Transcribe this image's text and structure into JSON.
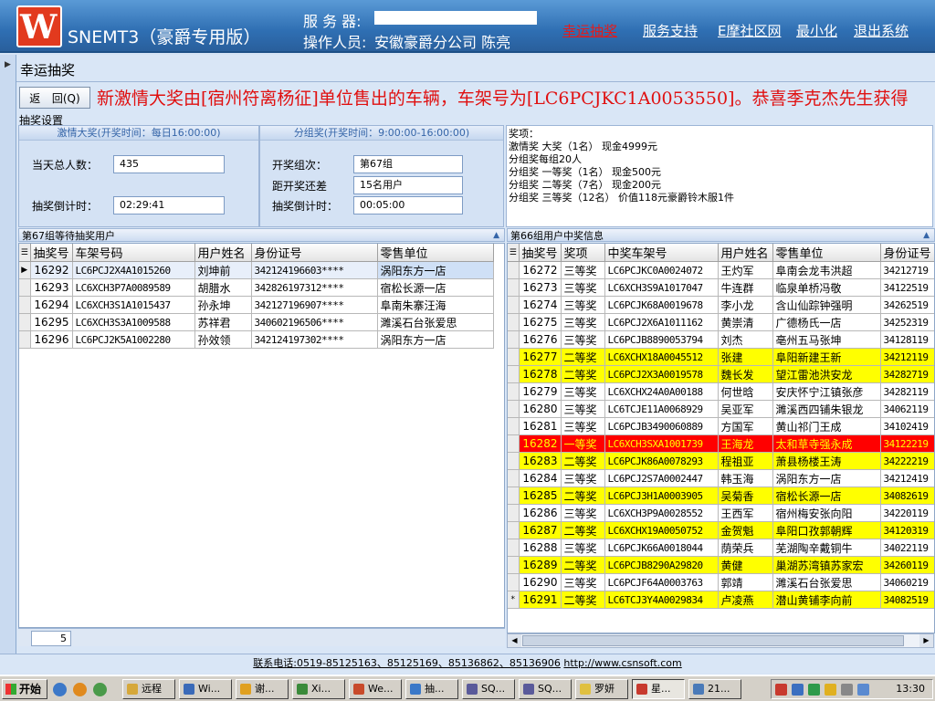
{
  "header": {
    "app_title": "SNEMT3（豪爵专用版）",
    "server_label": "服 务 器:",
    "operator_label": "操作人员:",
    "operator_value": "安徽豪爵分公司 陈亮",
    "nav": [
      "幸运抽奖",
      "服务支持",
      "E摩社区网",
      "最小化",
      "退出系统"
    ],
    "accent_color": "#e31b1b"
  },
  "page": {
    "title": "幸运抽奖",
    "back_label": "返",
    "back_label2": "回(Q)",
    "marquee": "新激情大奖由[宿州符离杨征]单位售出的车辆，车架号为[LC6PCJKC1A0053550]。恭喜季克杰先生获得"
  },
  "settings": {
    "title": "抽奖设置",
    "passion": {
      "heading": "激情大奖(开奖时间：每日16:00:00)",
      "total_label": "当天总人数：",
      "total_value": "435",
      "countdown_label": "抽奖倒计时：",
      "countdown_value": "02:29:41"
    },
    "group": {
      "heading": "分组奖(开奖时间：9:00:00-16:00:00)",
      "round_label": "开奖组次：",
      "round_value": "第67组",
      "gap_label": "距开奖还差",
      "gap_value": "15名用户",
      "countdown_label": "抽奖倒计时：",
      "countdown_value": "00:05:00"
    },
    "prizes": [
      "奖项：",
      "激情奖  大奖（1名）  现金4999元",
      "分组奖每组20人",
      "分组奖  一等奖（1名）  现金500元",
      "分组奖  二等奖（7名）  现金200元",
      "分组奖  三等奖（12名）  价值118元豪爵铃木服1件"
    ]
  },
  "waiting": {
    "title": "第67组等待抽奖用户",
    "columns": [
      "抽奖号",
      "车架号码",
      "用户姓名",
      "身份证号",
      "零售单位"
    ],
    "rows": [
      [
        "16292",
        "LC6PCJ2X4A1015260",
        "刘坤前",
        "342124196603****",
        "涡阳东方一店"
      ],
      [
        "16293",
        "LC6XCH3P7A0089589",
        "胡腊水",
        "342826197312****",
        "宿松长源一店"
      ],
      [
        "16294",
        "LC6XCH3S1A1015437",
        "孙永坤",
        "342127196907****",
        "阜南朱寨汪海"
      ],
      [
        "16295",
        "LC6XCH3S3A1009588",
        "苏祥君",
        "340602196506****",
        "濉溪石台张爱思"
      ],
      [
        "16296",
        "LC6PCJ2K5A1002280",
        "孙效领",
        "342124197302****",
        "涡阳东方一店"
      ]
    ],
    "count": "5"
  },
  "winners": {
    "title": "第66组用户中奖信息",
    "columns": [
      "抽奖号",
      "奖项",
      "中奖车架号",
      "用户姓名",
      "零售单位",
      "身份证号"
    ],
    "rows": [
      [
        "16272",
        "三等奖",
        "LC6PCJKC0A0024072",
        "王灼军",
        "阜南会龙韦洪超",
        "34212719"
      ],
      [
        "16273",
        "三等奖",
        "LC6XCH3S9A1017047",
        "牛连群",
        "临泉单桥冯敬",
        "34122519"
      ],
      [
        "16274",
        "三等奖",
        "LC6PCJK68A0019678",
        "李小龙",
        "含山仙踪钟强明",
        "34262519"
      ],
      [
        "16275",
        "三等奖",
        "LC6PCJ2X6A1011162",
        "黄崇清",
        "广德杨氏一店",
        "34252319"
      ],
      [
        "16276",
        "三等奖",
        "LC6PCJB8890053794",
        "刘杰",
        "亳州五马张坤",
        "34128119"
      ],
      [
        "16277",
        "二等奖",
        "LC6XCHX18A0045512",
        "张建",
        "阜阳新建王新",
        "34212119"
      ],
      [
        "16278",
        "二等奖",
        "LC6PCJ2X3A0019578",
        "魏长发",
        "望江雷池洪安龙",
        "34282719"
      ],
      [
        "16279",
        "三等奖",
        "LC6XCHX24A0A00188",
        "何世晗",
        "安庆怀宁江镇张彦",
        "34282119"
      ],
      [
        "16280",
        "三等奖",
        "LC6TCJE11A0068929",
        "吴亚军",
        "濉溪西四铺朱银龙",
        "34062119"
      ],
      [
        "16281",
        "三等奖",
        "LC6PCJB3490060889",
        "方国军",
        "黄山祁门王成",
        "34102419"
      ],
      [
        "16282",
        "一等奖",
        "LC6XCH3SXA1001739",
        "王海龙",
        "太和草寺强永成",
        "34122219"
      ],
      [
        "16283",
        "二等奖",
        "LC6PCJK86A0078293",
        "程祖亚",
        "萧县杨楼王涛",
        "34222219"
      ],
      [
        "16284",
        "三等奖",
        "LC6PCJ2S7A0002447",
        "韩玉海",
        "涡阳东方一店",
        "34212419"
      ],
      [
        "16285",
        "二等奖",
        "LC6PCJ3H1A0003905",
        "吴菊香",
        "宿松长源一店",
        "34082619"
      ],
      [
        "16286",
        "三等奖",
        "LC6XCH3P9A0028552",
        "王西军",
        "宿州梅安张向阳",
        "34220119"
      ],
      [
        "16287",
        "二等奖",
        "LC6XCHX19A0050752",
        "金贺魁",
        "阜阳口孜郭朝辉",
        "34120319"
      ],
      [
        "16288",
        "三等奖",
        "LC6PCJK66A0018044",
        "荫荣兵",
        "芜湖陶辛戴铜牛",
        "34022119"
      ],
      [
        "16289",
        "二等奖",
        "LC6PCJB8290A29820",
        "黄健",
        "巢湖苏湾镇苏家宏",
        "34260119"
      ],
      [
        "16290",
        "三等奖",
        "LC6PCJF64A0003763",
        "郭靖",
        "濉溪石台张爱思",
        "34060219"
      ],
      [
        "16291",
        "二等奖",
        "LC6TCJ3Y4A0029834",
        "卢凌燕",
        "潜山黄铺李向前",
        "34082519"
      ]
    ]
  },
  "contact": {
    "text": "联系电话:0519-85125163、85125169、85136862、85136906",
    "url": "http://www.csnsoft.com"
  },
  "taskbar": {
    "start": "开始",
    "tasks": [
      "远程",
      "Wi...",
      "谢...",
      "Xi...",
      "We...",
      "抽...",
      "SQ...",
      "SQ...",
      "罗妍",
      "星...",
      "21..."
    ],
    "clock": "13:30"
  }
}
